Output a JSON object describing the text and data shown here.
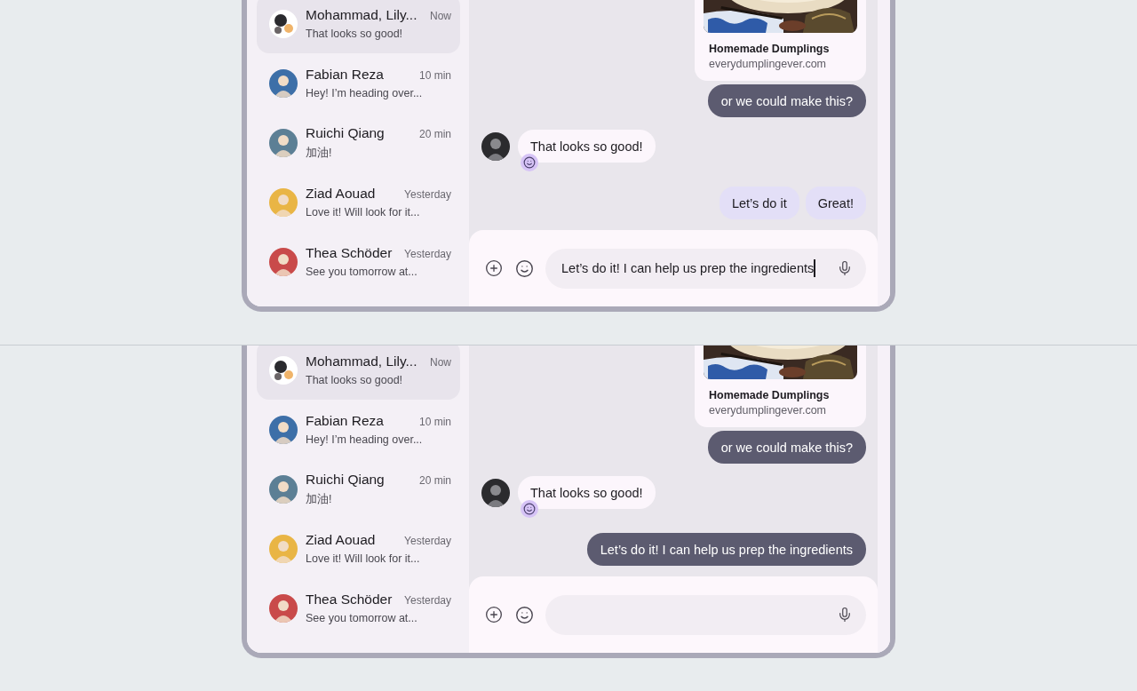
{
  "panels": [
    {
      "conversations": [
        {
          "kind": "group",
          "name": "Mohammad, Lily...",
          "time": "Now",
          "preview": "That looks so good!",
          "selected": true
        },
        {
          "kind": "person",
          "name": "Fabian Reza",
          "time": "10 min",
          "preview": "Hey! I’m heading over...",
          "selected": false
        },
        {
          "kind": "person",
          "name": "Ruichi Qiang",
          "time": "20 min",
          "preview": "加油!",
          "selected": false
        },
        {
          "kind": "person",
          "name": "Ziad Aouad",
          "time": "Yesterday",
          "preview": "Love it! Will look for it...",
          "selected": false
        },
        {
          "kind": "person",
          "name": "Thea Schöder",
          "time": "Yesterday",
          "preview": "See you tomorrow at...",
          "selected": false
        }
      ],
      "messages": [
        {
          "kind": "link",
          "title": "Homemade Dumplings",
          "url": "everydumplingever.com"
        },
        {
          "kind": "outgoing",
          "text": "or we could make this?"
        },
        {
          "kind": "incoming",
          "text": "That looks so good!",
          "reaction": true
        }
      ],
      "suggestions": [
        "Let’s do it",
        "Great!"
      ],
      "composer": {
        "value": "Let’s do it! I can help us prep the ingredients",
        "focused": true
      }
    },
    {
      "conversations": [
        {
          "kind": "group",
          "name": "Mohammad, Lily...",
          "time": "Now",
          "preview": "That looks so good!",
          "selected": true
        },
        {
          "kind": "person",
          "name": "Fabian Reza",
          "time": "10 min",
          "preview": "Hey! I’m heading over...",
          "selected": false
        },
        {
          "kind": "person",
          "name": "Ruichi Qiang",
          "time": "20 min",
          "preview": "加油!",
          "selected": false
        },
        {
          "kind": "person",
          "name": "Ziad Aouad",
          "time": "Yesterday",
          "preview": "Love it! Will look for it...",
          "selected": false
        },
        {
          "kind": "person",
          "name": "Thea Schöder",
          "time": "Yesterday",
          "preview": "See you tomorrow at...",
          "selected": false
        }
      ],
      "messages": [
        {
          "kind": "link",
          "title": "Homemade Dumplings",
          "url": "everydumplingever.com"
        },
        {
          "kind": "outgoing",
          "text": "or we could make this?"
        },
        {
          "kind": "incoming",
          "text": "That looks so good!",
          "reaction": true
        },
        {
          "kind": "outgoing",
          "text": "Let’s do it! I can help us prep the ingredients"
        }
      ],
      "composer": {
        "focused": false
      }
    }
  ]
}
